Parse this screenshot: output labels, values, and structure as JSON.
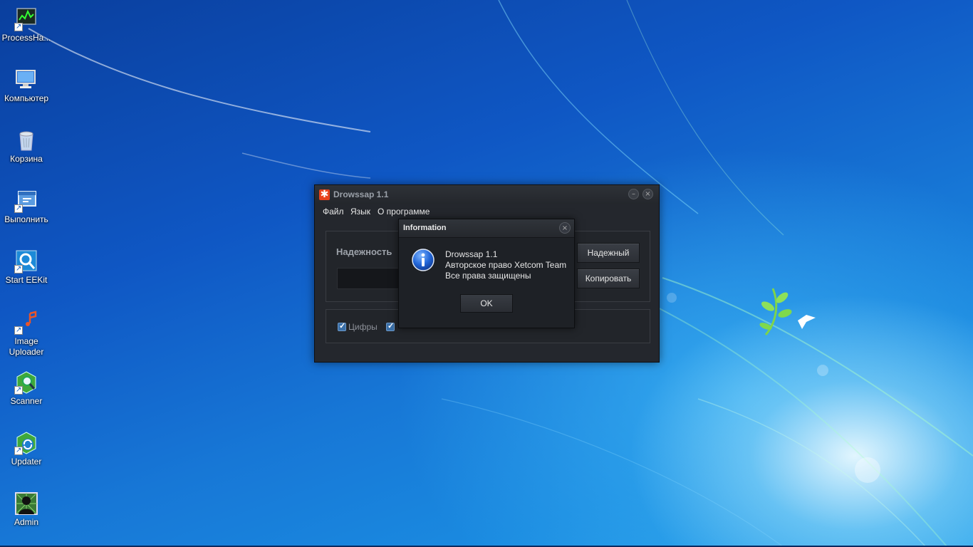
{
  "desktop": {
    "icons": [
      {
        "label": "ProcessHa...",
        "icon": "process-hacker-icon"
      },
      {
        "label": "Компьютер",
        "icon": "computer-icon"
      },
      {
        "label": "Корзина",
        "icon": "recycle-bin-icon"
      },
      {
        "label": "Выполнить",
        "icon": "run-icon"
      },
      {
        "label": "Start EEKit",
        "icon": "eekit-icon"
      },
      {
        "label_line1": "Image",
        "label_line2": "Uploader",
        "icon": "image-uploader-icon"
      },
      {
        "label": "Scanner",
        "icon": "scanner-icon"
      },
      {
        "label": "Updater",
        "icon": "updater-icon"
      },
      {
        "label": "Admin",
        "icon": "admin-user-icon"
      }
    ]
  },
  "app": {
    "title": "Drowssap 1.1",
    "logo_glyph": "✱",
    "minimize_glyph": "–",
    "close_glyph": "×",
    "menu": [
      "Файл",
      "Язык",
      "О программе"
    ],
    "strength_label": "Надежность",
    "buttons": {
      "strong": "Надежный",
      "copy": "Копировать"
    },
    "checkboxes": [
      {
        "label": "Цифры",
        "checked": true
      },
      {
        "label": "",
        "checked": true
      }
    ]
  },
  "dialog": {
    "title": "Information",
    "close_glyph": "×",
    "lines": [
      "Drowssap 1.1",
      "Авторское право Xetcom Team",
      "Все права защищены"
    ],
    "ok_label": "OK",
    "icon": "info-icon"
  },
  "colors": {
    "accent_logo": "#e8421c",
    "window_bg": "#24272d",
    "dialog_bg": "#1e2126",
    "checkbox": "#3a6fa8"
  }
}
